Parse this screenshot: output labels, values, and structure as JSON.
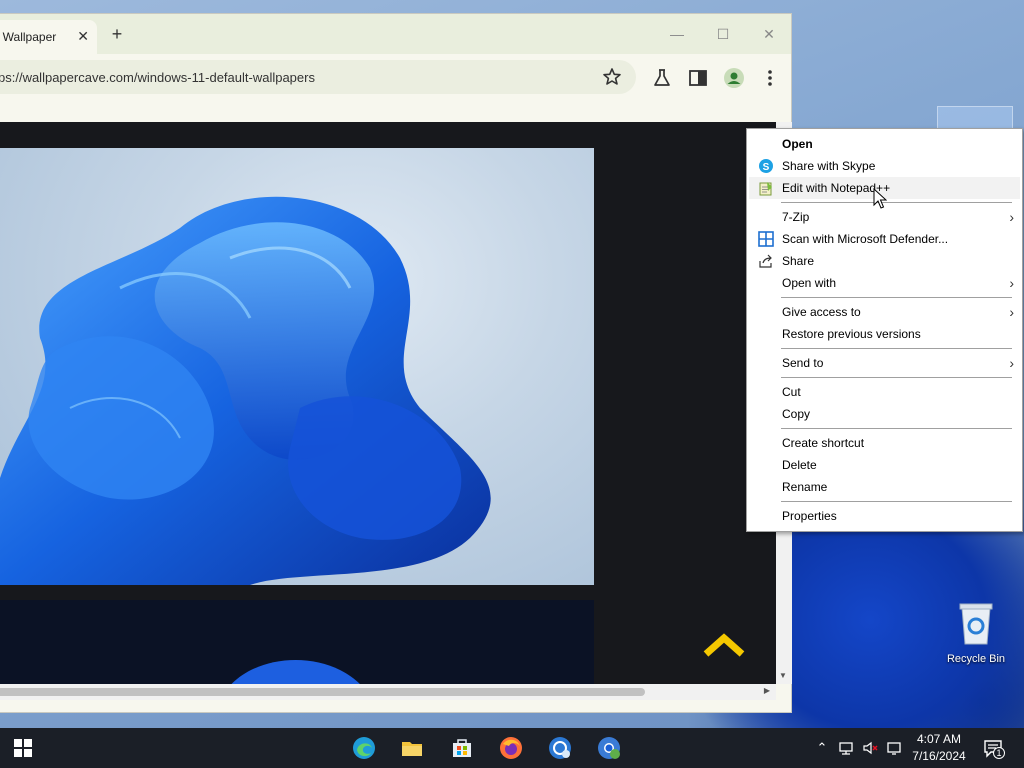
{
  "browser": {
    "tab_title": "t Wallpaper",
    "tab_close": "✕",
    "new_tab": "+",
    "url": "ps://wallpapercave.com/windows-11-default-wallpapers",
    "minimize": "—",
    "maximize": "☐",
    "close": "✕"
  },
  "context_menu": {
    "items": [
      {
        "label": "Open"
      },
      {
        "label": "Share with Skype",
        "icon": "skype-icon"
      },
      {
        "label": "Edit with Notepad++",
        "icon": "notepadpp-icon"
      },
      {
        "label": "7-Zip"
      },
      {
        "label": "Scan with Microsoft Defender...",
        "icon": "defender-icon"
      },
      {
        "label": "Share",
        "icon": "share-icon"
      },
      {
        "label": "Open with"
      },
      {
        "label": "Give access to"
      },
      {
        "label": "Restore previous versions"
      },
      {
        "label": "Send to"
      },
      {
        "label": "Cut"
      },
      {
        "label": "Copy"
      },
      {
        "label": "Create shortcut"
      },
      {
        "label": "Delete"
      },
      {
        "label": "Rename"
      },
      {
        "label": "Properties"
      }
    ]
  },
  "desktop": {
    "recycle_bin_label": "Recycle Bin"
  },
  "taskbar": {
    "time": "4:07 AM",
    "date": "7/16/2024",
    "notification_count": "1",
    "apps": [
      "edge-icon",
      "file-explorer-icon",
      "store-icon",
      "firefox-icon",
      "browser-icon",
      "chrome-icon"
    ]
  },
  "colors": {
    "accent": "#1a5fd6",
    "taskbar": "#1b1f27",
    "scroll_top_arrow": "#f5c800"
  }
}
